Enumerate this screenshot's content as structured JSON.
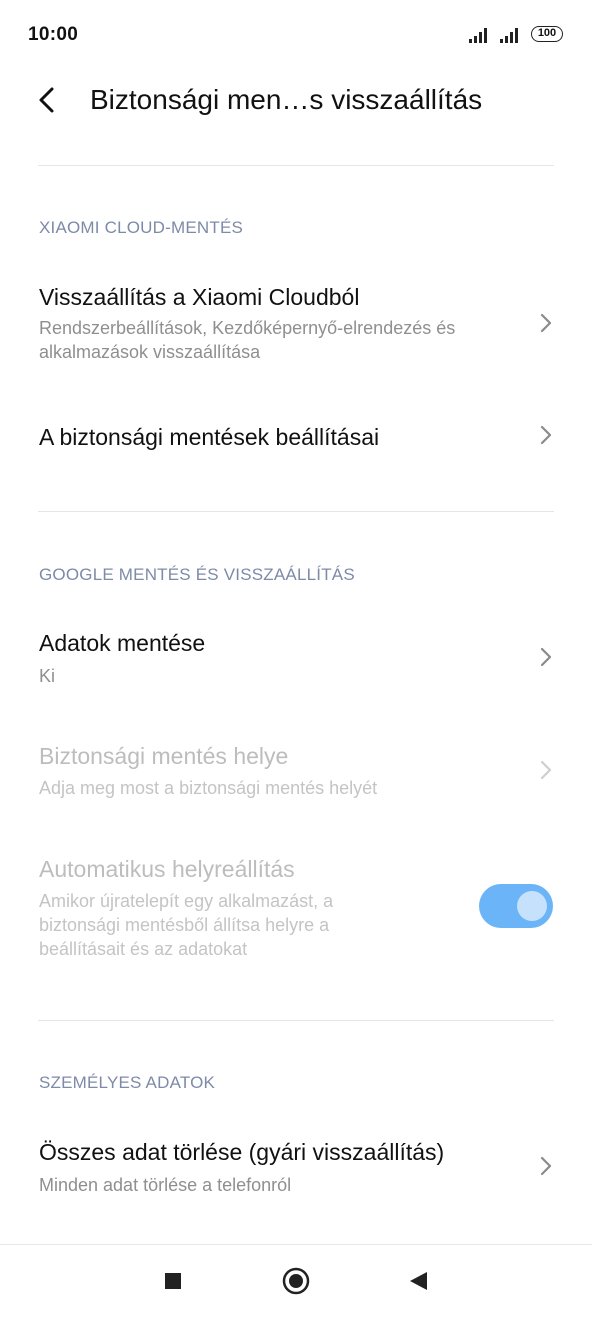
{
  "status_bar": {
    "time": "10:00",
    "battery": "100"
  },
  "app_bar": {
    "title": "Biztonsági men…s visszaállítás",
    "back_icon": "chevron-left-icon"
  },
  "sections": {
    "cloud": "XIAOMI CLOUD-MENTÉS",
    "google": "GOOGLE MENTÉS ÉS VISSZAÁLLÍTÁS",
    "personal": "SZEMÉLYES ADATOK"
  },
  "items": {
    "restore_cloud": {
      "title": "Visszaállítás a Xiaomi Cloudból",
      "subtitle": "Rendszerbeállítások, Kezdőképernyő-elrendezés és alkalmazások visszaállítása"
    },
    "backup_settings": {
      "title": "A biztonsági mentések beállításai"
    },
    "backup_data": {
      "title": "Adatok mentése",
      "subtitle": "Ki"
    },
    "backup_location": {
      "title": "Biztonsági mentés helye",
      "subtitle": "Adja meg most a biztonsági mentés helyét"
    },
    "auto_restore": {
      "title": "Automatikus helyreállítás",
      "subtitle": "Amikor újratelepít egy alkalmazást, a biztonsági mentésből állítsa helyre a beállításait és az adatokat",
      "toggle_on": true
    },
    "factory_reset": {
      "title": "Összes adat törlése (gyári visszaállítás)",
      "subtitle": "Minden adat törlése a telefonról"
    }
  },
  "colors": {
    "accent": "#6ab4f7",
    "section_header": "#7d8aa8",
    "subtitle": "#8f8f8f",
    "disabled": "#bdbdbd"
  },
  "nav_bar": {
    "icons": [
      "square-recents-icon",
      "circle-home-icon",
      "triangle-back-icon"
    ]
  }
}
